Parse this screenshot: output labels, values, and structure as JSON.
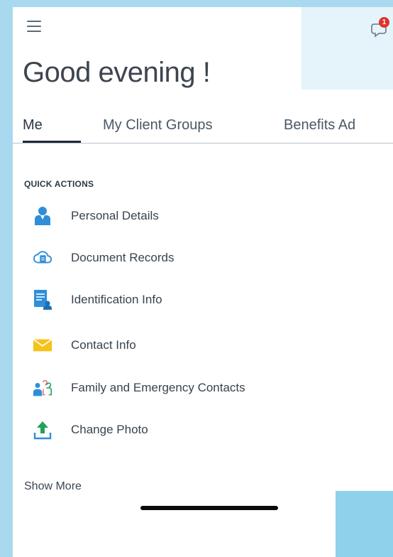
{
  "header": {
    "greeting": "Good evening !",
    "notification_count": "1"
  },
  "tabs": [
    {
      "label": "Me",
      "active": true
    },
    {
      "label": "My Client Groups",
      "active": false
    },
    {
      "label": "Benefits Ad",
      "active": false
    }
  ],
  "quick_actions": {
    "title": "QUICK ACTIONS",
    "items": [
      {
        "label": "Personal Details",
        "icon": "person-icon"
      },
      {
        "label": "Document Records",
        "icon": "cloud-document-icon"
      },
      {
        "label": "Identification Info",
        "icon": "id-card-icon"
      },
      {
        "label": "Contact Info",
        "icon": "envelope-icon"
      },
      {
        "label": "Family and Emergency Contacts",
        "icon": "family-icon"
      },
      {
        "label": "Change Photo",
        "icon": "upload-icon"
      }
    ]
  },
  "show_more": "Show More",
  "colors": {
    "accent_blue": "#2f8ed9",
    "envelope_yellow": "#f5c21b",
    "upload_green": "#21a05a",
    "badge_red": "#e0322c"
  }
}
